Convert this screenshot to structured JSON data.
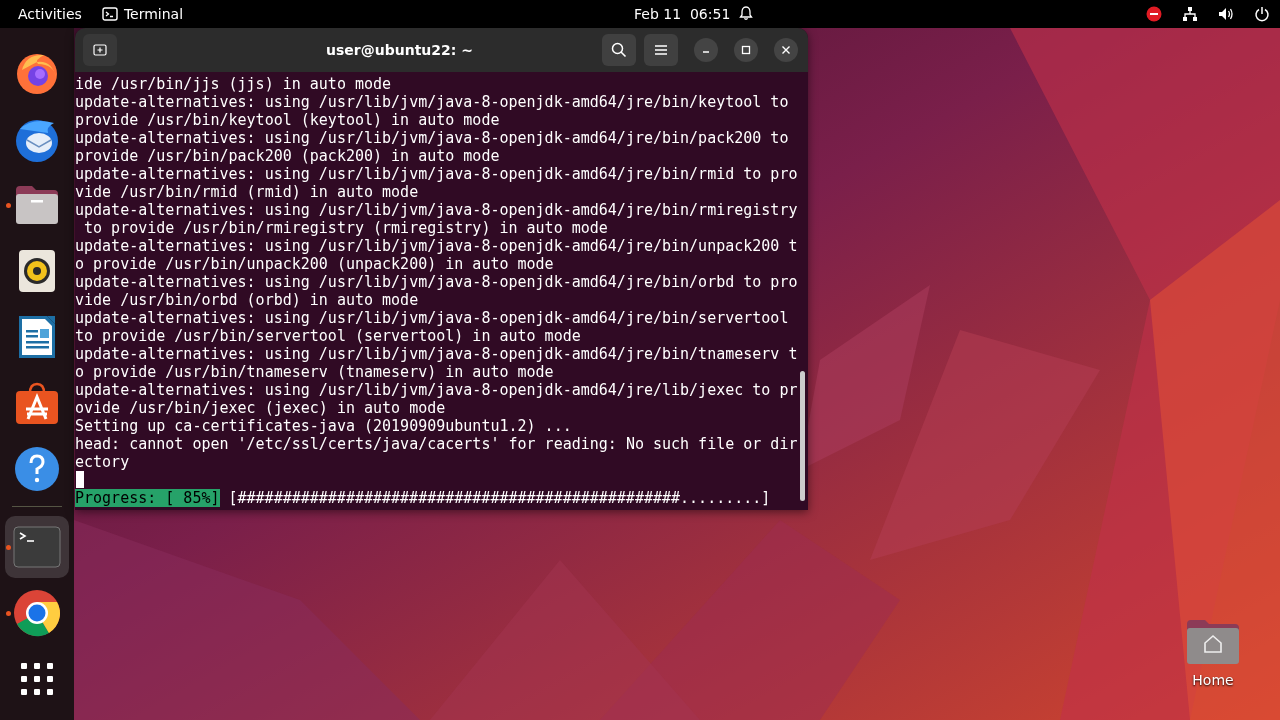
{
  "top_bar": {
    "activities": "Activities",
    "app_menu": "Terminal",
    "clock": "Feb 11  06:51"
  },
  "dock": {
    "items": [
      {
        "kind": "firefox",
        "running": false,
        "selected": false
      },
      {
        "kind": "thunderbird",
        "running": false,
        "selected": false
      },
      {
        "kind": "files",
        "running": true,
        "selected": false
      },
      {
        "kind": "rhythmbox",
        "running": false,
        "selected": false
      },
      {
        "kind": "writer",
        "running": false,
        "selected": false
      },
      {
        "kind": "appcenter",
        "running": false,
        "selected": false
      },
      {
        "kind": "help",
        "running": false,
        "selected": false
      },
      {
        "kind": "terminal",
        "running": true,
        "selected": true
      },
      {
        "kind": "chrome",
        "running": true,
        "selected": false
      },
      {
        "kind": "apps",
        "running": false,
        "selected": false
      }
    ]
  },
  "terminal": {
    "title": "user@ubuntu22: ~",
    "lines": [
      "ide /usr/bin/jjs (jjs) in auto mode",
      "update-alternatives: using /usr/lib/jvm/java-8-openjdk-amd64/jre/bin/keytool to",
      "provide /usr/bin/keytool (keytool) in auto mode",
      "update-alternatives: using /usr/lib/jvm/java-8-openjdk-amd64/jre/bin/pack200 to",
      "provide /usr/bin/pack200 (pack200) in auto mode",
      "update-alternatives: using /usr/lib/jvm/java-8-openjdk-amd64/jre/bin/rmid to pro",
      "vide /usr/bin/rmid (rmid) in auto mode",
      "update-alternatives: using /usr/lib/jvm/java-8-openjdk-amd64/jre/bin/rmiregistry",
      " to provide /usr/bin/rmiregistry (rmiregistry) in auto mode",
      "update-alternatives: using /usr/lib/jvm/java-8-openjdk-amd64/jre/bin/unpack200 t",
      "o provide /usr/bin/unpack200 (unpack200) in auto mode",
      "update-alternatives: using /usr/lib/jvm/java-8-openjdk-amd64/jre/bin/orbd to pro",
      "vide /usr/bin/orbd (orbd) in auto mode",
      "update-alternatives: using /usr/lib/jvm/java-8-openjdk-amd64/jre/bin/servertool",
      "to provide /usr/bin/servertool (servertool) in auto mode",
      "update-alternatives: using /usr/lib/jvm/java-8-openjdk-amd64/jre/bin/tnameserv t",
      "o provide /usr/bin/tnameserv (tnameserv) in auto mode",
      "update-alternatives: using /usr/lib/jvm/java-8-openjdk-amd64/jre/lib/jexec to pr",
      "ovide /usr/bin/jexec (jexec) in auto mode",
      "Setting up ca-certificates-java (20190909ubuntu1.2) ...",
      "head: cannot open '/etc/ssl/certs/java/cacerts' for reading: No such file or dir",
      "ectory"
    ],
    "progress": {
      "label": "Progress: [ 85%]",
      "bar": "[#################################################.........]"
    }
  },
  "desktop_icons": [
    {
      "label": "Home"
    }
  ]
}
